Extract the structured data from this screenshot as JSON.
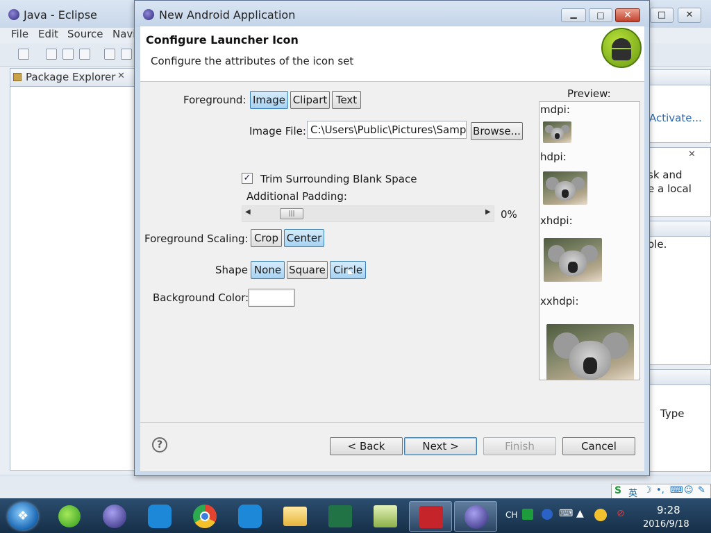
{
  "eclipse": {
    "title": "Java - Eclipse",
    "menu": [
      "File",
      "Edit",
      "Source",
      "Navi"
    ],
    "package_explorer": "Package Explorer",
    "right_panel_texts": [
      "Activate...",
      "sk and",
      "e a local",
      "ole.",
      "Type"
    ]
  },
  "dialog": {
    "title": "New Android Application",
    "header_title": "Configure Launcher Icon",
    "header_subtitle": "Configure the attributes of the icon set",
    "foreground_label": "Foreground:",
    "foreground_options": [
      "Image",
      "Clipart",
      "Text"
    ],
    "foreground_selected": "Image",
    "image_file_label": "Image File:",
    "image_file_value": "C:\\Users\\Public\\Pictures\\Sampl",
    "browse_label": "Browse...",
    "trim_label": "Trim Surrounding Blank Space",
    "trim_checked": true,
    "padding_label": "Additional Padding:",
    "padding_value": "0%",
    "padding_fraction": 0.0,
    "scaling_label": "Foreground Scaling:",
    "scaling_options": [
      "Crop",
      "Center"
    ],
    "scaling_selected": "Center",
    "shape_label": "Shape",
    "shape_options": [
      "None",
      "Square",
      "Circle"
    ],
    "shape_selected": "None",
    "shape_hovered": "Circle",
    "background_label": "Background Color:",
    "background_color": "#ffffff",
    "preview_label": "Preview:",
    "preview_densities": [
      "mdpi:",
      "hdpi:",
      "xhdpi:",
      "xxhdpi:"
    ],
    "buttons": {
      "back": "< Back",
      "next": "Next >",
      "finish": "Finish",
      "cancel": "Cancel"
    }
  },
  "taskbar": {
    "lang": "CH",
    "time": "9:28",
    "date": "2016/9/18",
    "ime": "英"
  },
  "colors": {
    "selected_button": "#a7d2f1",
    "close_button": "#c0412b",
    "taskbar": "#1d3b5a"
  }
}
